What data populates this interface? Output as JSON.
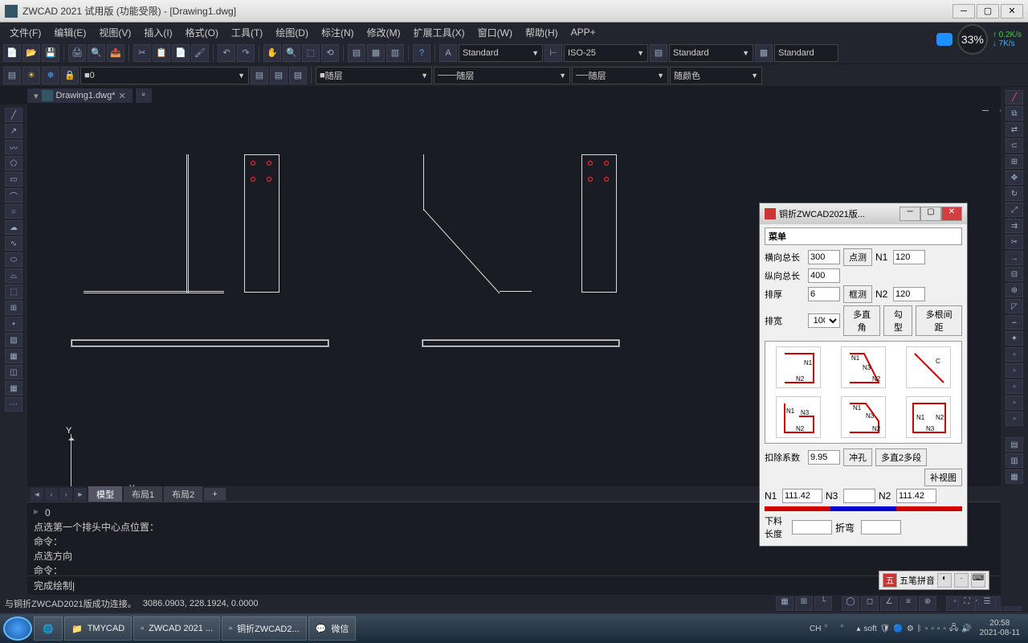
{
  "titlebar": {
    "title": "ZWCAD 2021 试用版 (功能受限) - [Drawing1.dwg]"
  },
  "menu": [
    "文件(F)",
    "编辑(E)",
    "视图(V)",
    "插入(I)",
    "格式(O)",
    "工具(T)",
    "绘图(D)",
    "标注(N)",
    "修改(M)",
    "扩展工具(X)",
    "窗口(W)",
    "帮助(H)",
    "APP+"
  ],
  "hud": {
    "pct": "33%",
    "up": "0.2K/s",
    "down": "7K/s"
  },
  "styles": {
    "text": "Standard",
    "dim": "ISO-25",
    "mleader": "Standard",
    "table": "Standard"
  },
  "layer": {
    "name": "0",
    "linetype": "随层",
    "lineweight": "随层",
    "lineweight2": "随层",
    "color": "随颜色"
  },
  "tab": {
    "name": "Drawing1.dwg*"
  },
  "modeltabs": {
    "model": "模型",
    "layout1": "布局1",
    "layout2": "布局2"
  },
  "cmd": {
    "l0": "0",
    "l1": "点选第一个排头中心点位置：",
    "l2": "命令：",
    "l3": "点选方向",
    "l4": "命令：",
    "input": "完成绘制"
  },
  "status": {
    "msg": "与铜折ZWCAD2021版成功连接。",
    "coords": "3086.0903, 228.1924, 0.0000"
  },
  "dialog": {
    "title": "铜折ZWCAD2021版...",
    "menu": "菜单",
    "hlen_label": "横向总长",
    "hlen": "300",
    "vlen_label": "纵向总长",
    "vlen": "400",
    "thick_label": "排厚",
    "thick": "6",
    "width_label": "排宽",
    "width": "100",
    "dianze": "点测",
    "kuangze": "框测",
    "n1_label": "N1",
    "n1": "120",
    "n2_label": "N2",
    "n2": "120",
    "duozhijiao": "多直角",
    "gouxing": "勾型",
    "duogenjianju": "多根间距",
    "kou_label": "扣除系数",
    "kou": "9.95",
    "chongkong": "冲孔",
    "duozhi2": "多直2多段",
    "bushitu": "补视图",
    "bn1_label": "N1",
    "bn1": "111.42",
    "bn3_label": "N3",
    "bn3": "",
    "bn2_label": "N2",
    "bn2": "111.42",
    "xialiao": "下料长度",
    "zhewan": "折弯"
  },
  "ime": {
    "mode": "五笔拼音"
  },
  "taskbar": {
    "folder": "TMYCAD",
    "app1": "ZWCAD 2021 ...",
    "app2": "铜折ZWCAD2...",
    "wechat": "微信",
    "ch": "CH",
    "soft": "soft",
    "time": "20:58",
    "date": "2021-08-11"
  }
}
